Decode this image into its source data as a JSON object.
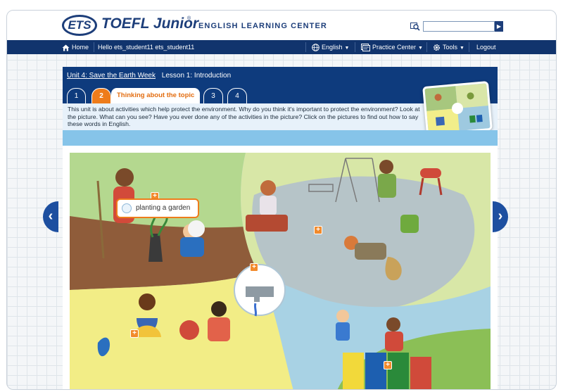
{
  "header": {
    "logo_ets": "ETS",
    "logo_product": "TOEFL Junior",
    "logo_reg": "®",
    "logo_subtitle": "ENGLISH LEARNING CENTER",
    "search_placeholder": "",
    "search_go": "▶"
  },
  "nav": {
    "home": "Home",
    "greeting": "Hello ets_student11 ets_student11",
    "language": "English",
    "practice_center": "Practice Center",
    "tools": "Tools",
    "logout": "Logout"
  },
  "lesson": {
    "unit": "Unit 4: Save the Earth Week",
    "lesson": "Lesson 1: Introduction",
    "tabs": [
      "1",
      "2",
      "3",
      "4"
    ],
    "active_tab_label": "Thinking about the topic",
    "instructions": "This unit is about activities which help protect the environment. Why do you think it's important to protect the environment? Look at the picture. What can you see? Have you ever done any of the activities in the picture? Click on the pictures to find out how to say these words in English."
  },
  "scene": {
    "tooltip": "planting a garden",
    "hotspot_symbol": "+"
  },
  "arrows": {
    "prev": "‹",
    "next": "›"
  },
  "colors": {
    "brand_navy": "#11346d",
    "panel_blue": "#0e3b7d",
    "accent_orange": "#ee7c1b",
    "light_blue": "#86c4e9"
  }
}
